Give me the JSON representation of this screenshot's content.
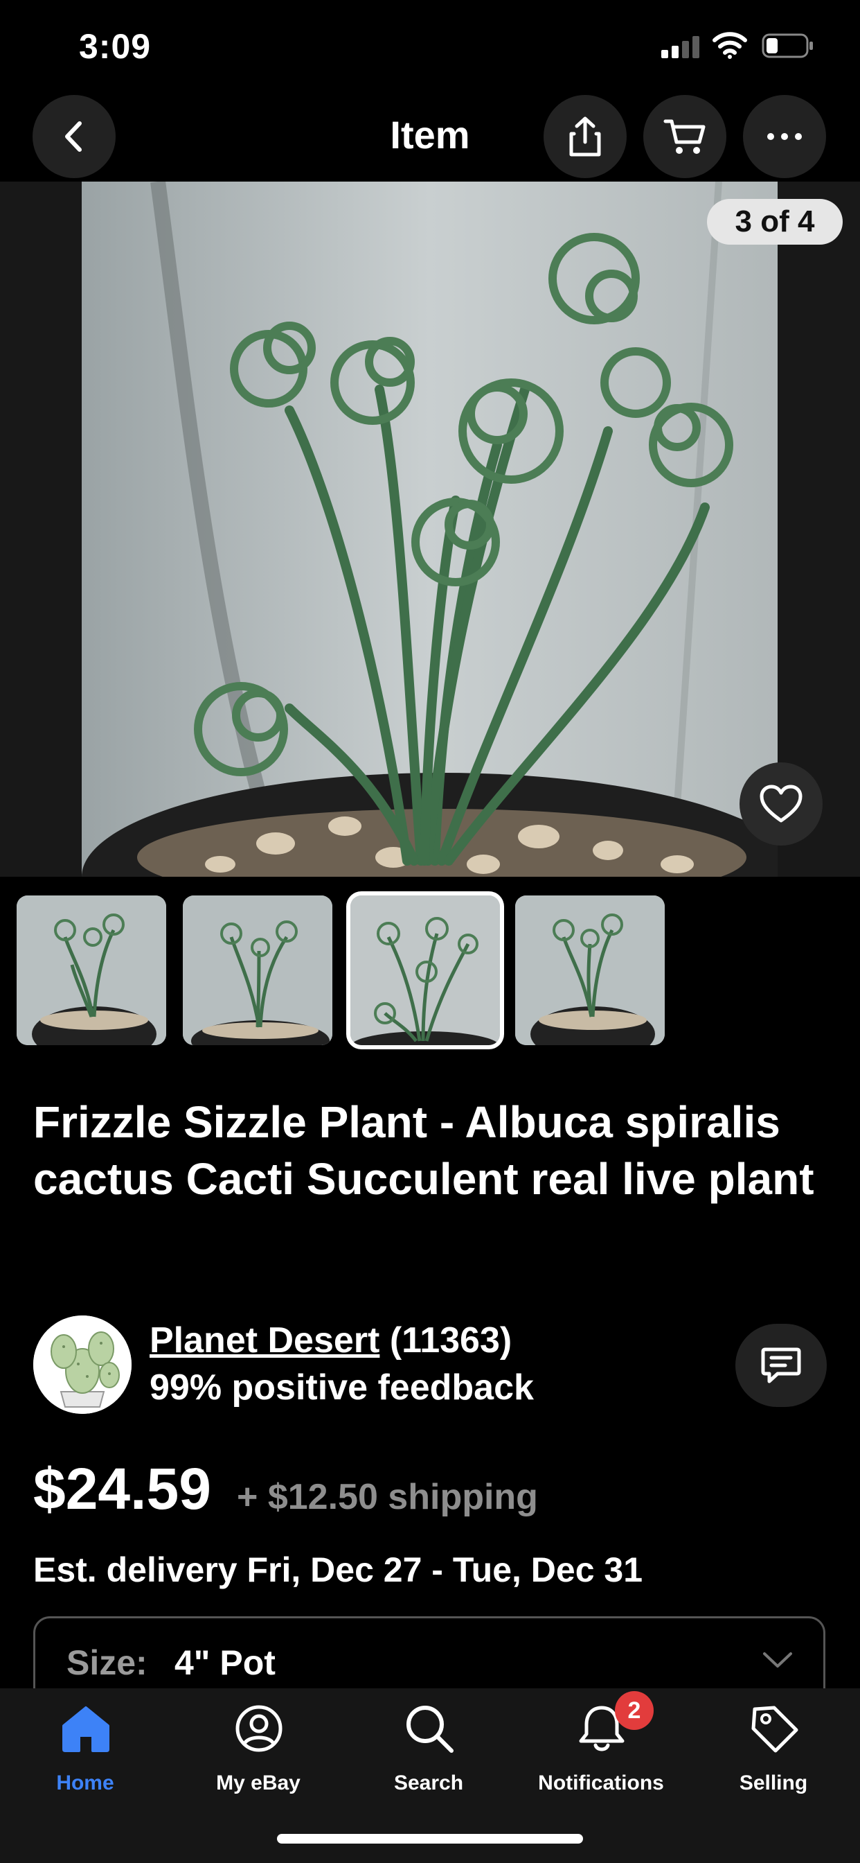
{
  "status_bar": {
    "time": "3:09"
  },
  "header": {
    "title": "Item",
    "back_icon": "chevron-left-icon",
    "share_icon": "share-icon",
    "cart_icon": "cart-icon",
    "more_icon": "ellipsis-icon"
  },
  "gallery": {
    "counter": "3 of 4",
    "current_index": 3,
    "total": 4,
    "favorite_icon": "heart-icon"
  },
  "listing": {
    "title": "Frizzle Sizzle Plant - Albuca spiralis cactus Cacti Succulent real live plant",
    "seller": {
      "name": "Planet Desert",
      "feedback_count": "(11363)",
      "feedback_percent": "99% positive feedback"
    },
    "price": "$24.59",
    "shipping": "+ $12.50 shipping",
    "delivery": "Est. delivery Fri, Dec 27 - Tue, Dec 31",
    "size": {
      "label": "Size:",
      "value": "4\" Pot"
    }
  },
  "tabbar": {
    "items": [
      {
        "label": "Home",
        "icon": "home-icon",
        "active": true
      },
      {
        "label": "My eBay",
        "icon": "user-icon",
        "active": false
      },
      {
        "label": "Search",
        "icon": "search-icon",
        "active": false
      },
      {
        "label": "Notifications",
        "icon": "bell-icon",
        "active": false,
        "badge": "2"
      },
      {
        "label": "Selling",
        "icon": "tag-icon",
        "active": false
      }
    ]
  },
  "colors": {
    "accent": "#3d82f7",
    "badge": "#e23c3c",
    "background": "#000000"
  }
}
